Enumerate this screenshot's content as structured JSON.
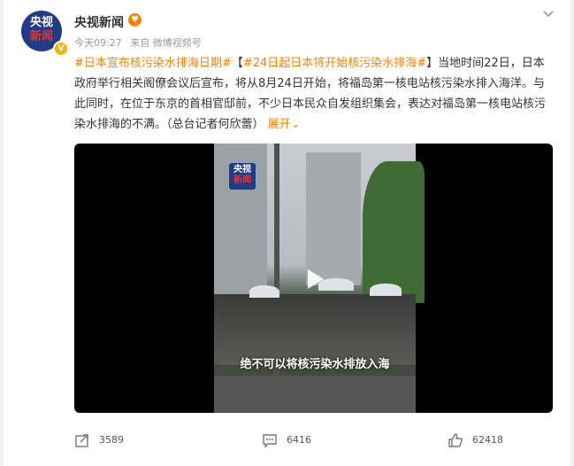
{
  "header": {
    "user_name": "央视新闻",
    "avatar_text_top": "央视",
    "avatar_text_bottom": "新闻",
    "time": "今天09:27",
    "source": "来自 微博视频号"
  },
  "post": {
    "topic1": "#日本宣布核污染水排海日期#",
    "lead": "【",
    "topic2": "#24日起日本将开始核污染水排海#",
    "close": "】",
    "body": "当地时间22日，日本政府举行相关阁僚会议后宣布，将从8月24日开始，将福岛第一核电站核污染水排入海洋。与此同时，在位于东京的首相官邸前，不少日本民众自发组织集会，表达对福岛第一核电站核污染水排海的不满。（总台记者何欣蕾）",
    "expand": "展开"
  },
  "video": {
    "logo_top": "央视",
    "logo_bottom": "新闻",
    "subtitle": "绝不可以将核污染水排放入海"
  },
  "actions": {
    "share_count": "3589",
    "comment_count": "6416",
    "like_count": "62418"
  },
  "colors": {
    "accent": "#ff8200",
    "avatar_bg": "#1f3c88"
  }
}
